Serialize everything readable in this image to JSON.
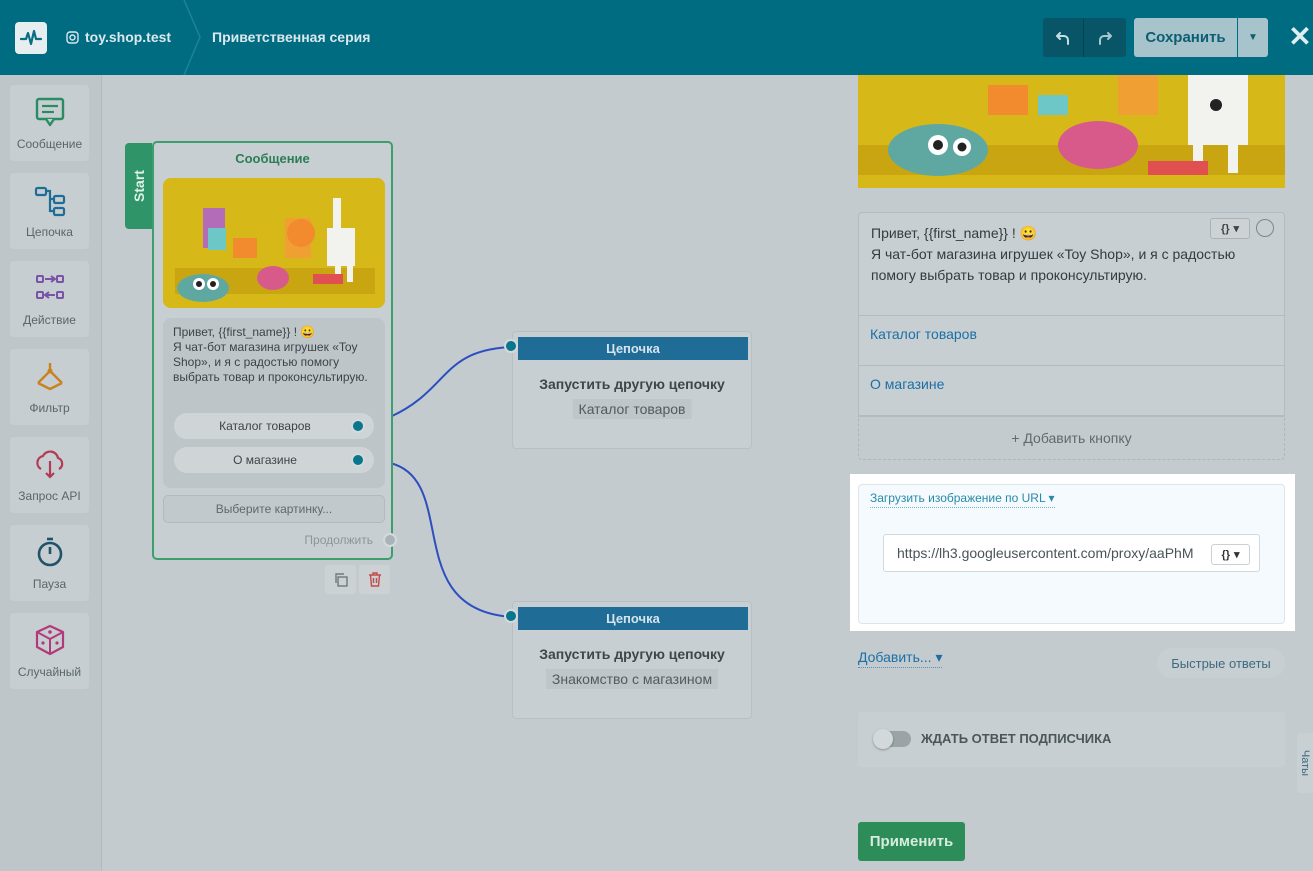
{
  "header": {
    "account": "toy.shop.test",
    "flow_title": "Приветственная серия",
    "save_label": "Сохранить"
  },
  "toolbar": {
    "items": [
      {
        "label": "Сообщение",
        "icon": "message-icon"
      },
      {
        "label": "Цепочка",
        "icon": "chain-icon"
      },
      {
        "label": "Действие",
        "icon": "action-icon"
      },
      {
        "label": "Фильтр",
        "icon": "filter-icon"
      },
      {
        "label": "Запрос API",
        "icon": "api-request-icon"
      },
      {
        "label": "Пауза",
        "icon": "stopwatch-icon"
      },
      {
        "label": "Случайный",
        "icon": "dice-icon"
      }
    ]
  },
  "canvas": {
    "message_node": {
      "start_label": "Start",
      "title": "Сообщение",
      "text": "Привет,  {{first_name}} ! 😀\nЯ чат-бот магазина игрушек «Toy Shop», и я с радостью помогу выбрать товар и проконсультирую.",
      "buttons": [
        "Каталог товаров",
        "О магазине"
      ],
      "pick_image": "Выберите картинку...",
      "continue": "Продолжить"
    },
    "chain_nodes": [
      {
        "title": "Цепочка",
        "subtitle": "Запустить другую цепочку",
        "target": "Каталог товаров"
      },
      {
        "title": "Цепочка",
        "subtitle": "Запустить другую цепочку",
        "target": "Знакомство с магазином"
      }
    ]
  },
  "panel": {
    "text": "Привет,  {{first_name}} ! 😀\nЯ чат-бот магазина игрушек «Toy Shop», и я с радостью помогу выбрать товар и проконсультирую.",
    "var_button": "{}",
    "buttons": [
      "Каталог товаров",
      "О магазине"
    ],
    "add_button": "+ Добавить кнопку",
    "url_upload_label": "Загрузить изображение по URL",
    "url_value": "https://lh3.googleusercontent.com/proxy/aaPhM",
    "add_more": "Добавить...",
    "quick_replies": "Быстрые ответы",
    "wait_label": "ЖДАТЬ ОТВЕТ ПОДПИСЧИКА",
    "apply": "Применить",
    "chats_tab": "Чаты"
  },
  "colors": {
    "header": "#006c82",
    "accent_green": "#2c8d59",
    "chain_head": "#1f6c96",
    "link": "#1c6fa6"
  }
}
